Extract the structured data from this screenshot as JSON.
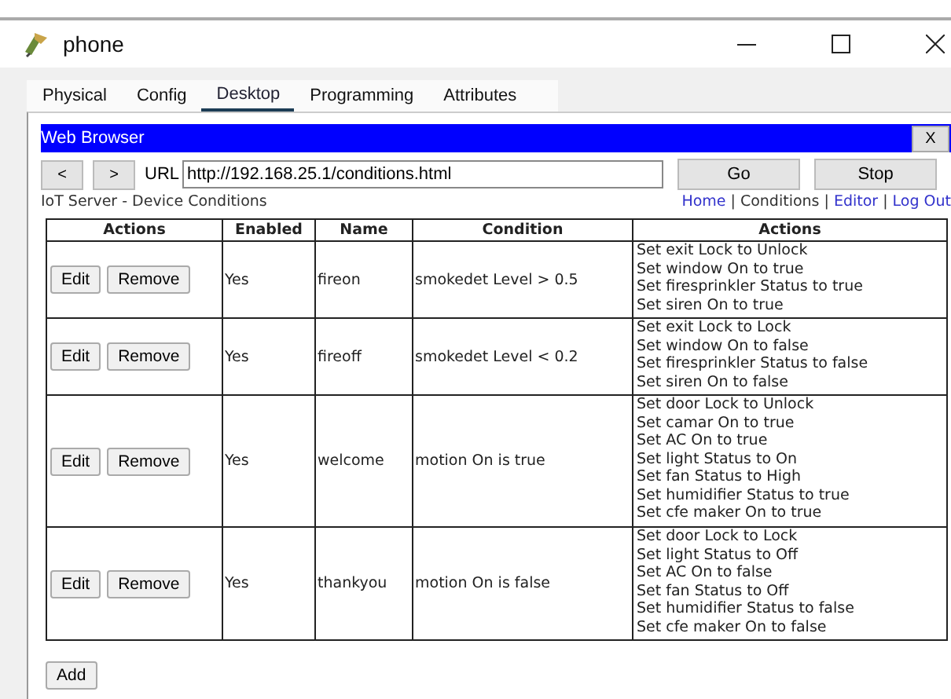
{
  "window": {
    "title": "phone"
  },
  "tabs": [
    {
      "label": "Physical",
      "selected": false
    },
    {
      "label": "Config",
      "selected": false
    },
    {
      "label": "Desktop",
      "selected": true
    },
    {
      "label": "Programming",
      "selected": false
    },
    {
      "label": "Attributes",
      "selected": false
    }
  ],
  "browser": {
    "title": "Web Browser",
    "close": "X",
    "back": "<",
    "forward": ">",
    "url_label": "URL",
    "url": "http://192.168.25.1/conditions.html",
    "go": "Go",
    "stop": "Stop"
  },
  "page": {
    "heading": "IoT Server - Device Conditions",
    "nav": [
      {
        "label": "Home",
        "kind": "link"
      },
      {
        "label": "|",
        "kind": "sep"
      },
      {
        "label": "Conditions",
        "kind": "text"
      },
      {
        "label": "|",
        "kind": "sep"
      },
      {
        "label": "Editor",
        "kind": "link"
      },
      {
        "label": "|",
        "kind": "sep"
      },
      {
        "label": "Log Out",
        "kind": "link"
      }
    ]
  },
  "table": {
    "columns": [
      "Actions",
      "Enabled",
      "Name",
      "Condition",
      "Actions"
    ],
    "rows": [
      {
        "edit": "Edit",
        "remove": "Remove",
        "enabled": "Yes",
        "name": "fireon",
        "condition": "smokedet Level > 0.5",
        "actions": [
          "Set exit Lock to Unlock",
          "Set window On to true",
          "Set firesprinkler Status to true",
          "Set siren On to true"
        ]
      },
      {
        "edit": "Edit",
        "remove": "Remove",
        "enabled": "Yes",
        "name": "fireoff",
        "condition": "smokedet Level < 0.2",
        "actions": [
          "Set exit Lock to Lock",
          "Set window On to false",
          "Set firesprinkler Status to false",
          "Set siren On to false"
        ]
      },
      {
        "edit": "Edit",
        "remove": "Remove",
        "enabled": "Yes",
        "name": "welcome",
        "condition": "motion On is true",
        "actions": [
          "Set door Lock to Unlock",
          "Set camar On to true",
          "Set AC On to true",
          "Set light Status to On",
          "Set fan Status to High",
          "Set humidifier Status to true",
          "Set cfe maker On to true"
        ]
      },
      {
        "edit": "Edit",
        "remove": "Remove",
        "enabled": "Yes",
        "name": "thankyou",
        "condition": "motion On is false",
        "actions": [
          "Set door Lock to Lock",
          "Set light Status to Off",
          "Set AC On to false",
          "Set fan Status to Off",
          "Set humidifier Status to false",
          "Set cfe maker On to false"
        ]
      }
    ]
  },
  "add": "Add"
}
